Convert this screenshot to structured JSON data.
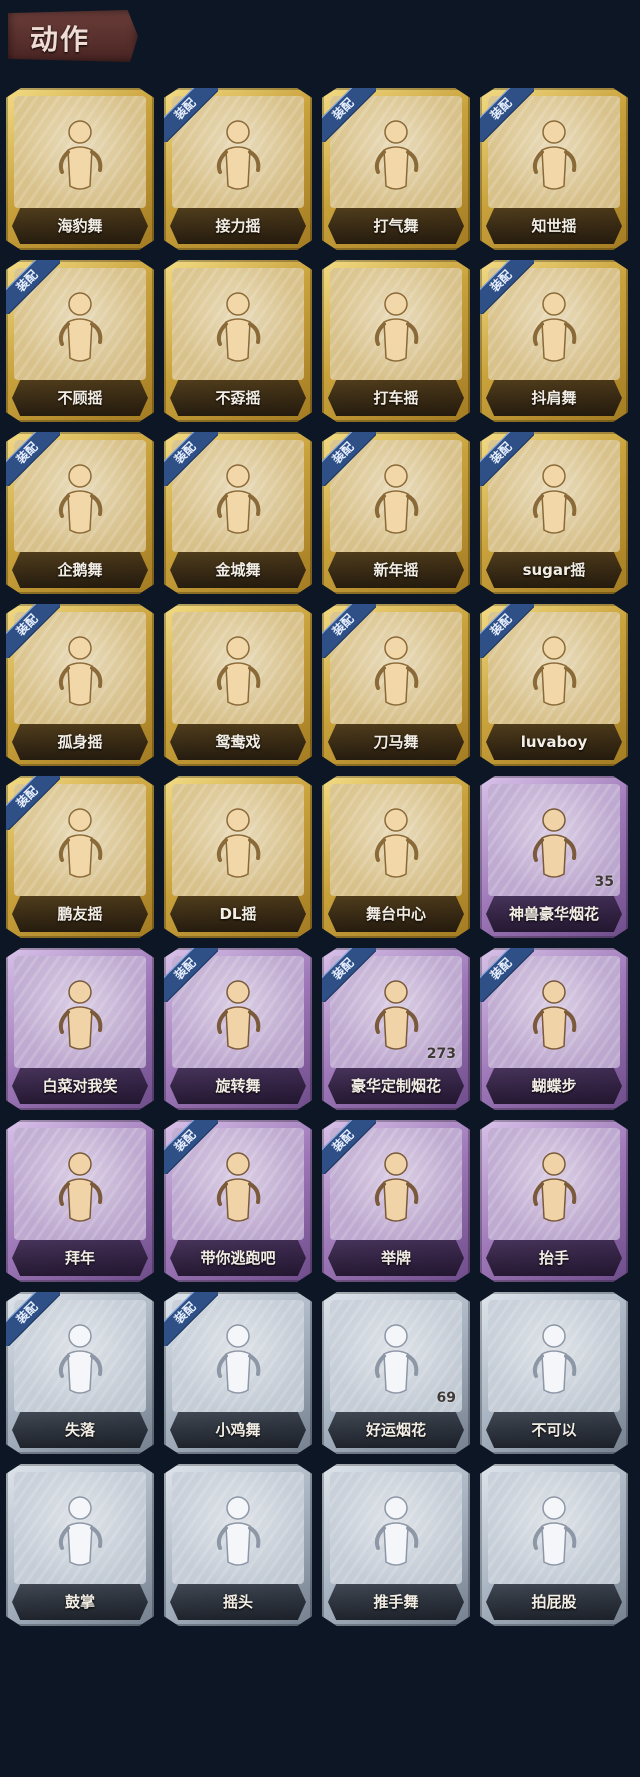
{
  "header": {
    "title": "动作"
  },
  "badge_text": "装配",
  "colors": {
    "gold": "#c9a23c",
    "purple": "#9e78b8",
    "silver": "#a8b4c2",
    "badge": "#2e5087"
  },
  "cards": [
    {
      "name": "海豹舞",
      "tier": "gold",
      "equipped": false,
      "count": ""
    },
    {
      "name": "接力摇",
      "tier": "gold",
      "equipped": true,
      "count": ""
    },
    {
      "name": "打气舞",
      "tier": "gold",
      "equipped": true,
      "count": ""
    },
    {
      "name": "知世摇",
      "tier": "gold",
      "equipped": true,
      "count": ""
    },
    {
      "name": "不顾摇",
      "tier": "gold",
      "equipped": true,
      "count": ""
    },
    {
      "name": "不孬摇",
      "tier": "gold",
      "equipped": false,
      "count": ""
    },
    {
      "name": "打车摇",
      "tier": "gold",
      "equipped": false,
      "count": ""
    },
    {
      "name": "抖肩舞",
      "tier": "gold",
      "equipped": true,
      "count": ""
    },
    {
      "name": "企鹅舞",
      "tier": "gold",
      "equipped": true,
      "count": ""
    },
    {
      "name": "金城舞",
      "tier": "gold",
      "equipped": true,
      "count": ""
    },
    {
      "name": "新年摇",
      "tier": "gold",
      "equipped": true,
      "count": ""
    },
    {
      "name": "sugar摇",
      "tier": "gold",
      "equipped": true,
      "count": ""
    },
    {
      "name": "孤身摇",
      "tier": "gold",
      "equipped": true,
      "count": ""
    },
    {
      "name": "鸳鸯戏",
      "tier": "gold",
      "equipped": false,
      "count": ""
    },
    {
      "name": "刀马舞",
      "tier": "gold",
      "equipped": true,
      "count": ""
    },
    {
      "name": "luvaboy",
      "tier": "gold",
      "equipped": true,
      "count": ""
    },
    {
      "name": "鹏友摇",
      "tier": "gold",
      "equipped": true,
      "count": ""
    },
    {
      "name": "DL摇",
      "tier": "gold",
      "equipped": false,
      "count": ""
    },
    {
      "name": "舞台中心",
      "tier": "gold",
      "equipped": false,
      "count": ""
    },
    {
      "name": "神兽豪华烟花",
      "tier": "purple",
      "equipped": false,
      "count": "35"
    },
    {
      "name": "白菜对我笑",
      "tier": "purple",
      "equipped": false,
      "count": ""
    },
    {
      "name": "旋转舞",
      "tier": "purple",
      "equipped": true,
      "count": ""
    },
    {
      "name": "豪华定制烟花",
      "tier": "purple",
      "equipped": true,
      "count": "273"
    },
    {
      "name": "蝴蝶步",
      "tier": "purple",
      "equipped": true,
      "count": ""
    },
    {
      "name": "拜年",
      "tier": "purple",
      "equipped": false,
      "count": ""
    },
    {
      "name": "带你逃跑吧",
      "tier": "purple",
      "equipped": true,
      "count": ""
    },
    {
      "name": "举牌",
      "tier": "purple",
      "equipped": true,
      "count": ""
    },
    {
      "name": "抬手",
      "tier": "purple",
      "equipped": false,
      "count": ""
    },
    {
      "name": "失落",
      "tier": "silver",
      "equipped": true,
      "count": ""
    },
    {
      "name": "小鸡舞",
      "tier": "silver",
      "equipped": true,
      "count": ""
    },
    {
      "name": "好运烟花",
      "tier": "silver",
      "equipped": false,
      "count": "69"
    },
    {
      "name": "不可以",
      "tier": "silver",
      "equipped": false,
      "count": ""
    },
    {
      "name": "鼓掌",
      "tier": "silver",
      "equipped": false,
      "count": ""
    },
    {
      "name": "摇头",
      "tier": "silver",
      "equipped": false,
      "count": ""
    },
    {
      "name": "推手舞",
      "tier": "silver",
      "equipped": false,
      "count": ""
    },
    {
      "name": "拍屁股",
      "tier": "silver",
      "equipped": false,
      "count": ""
    }
  ]
}
